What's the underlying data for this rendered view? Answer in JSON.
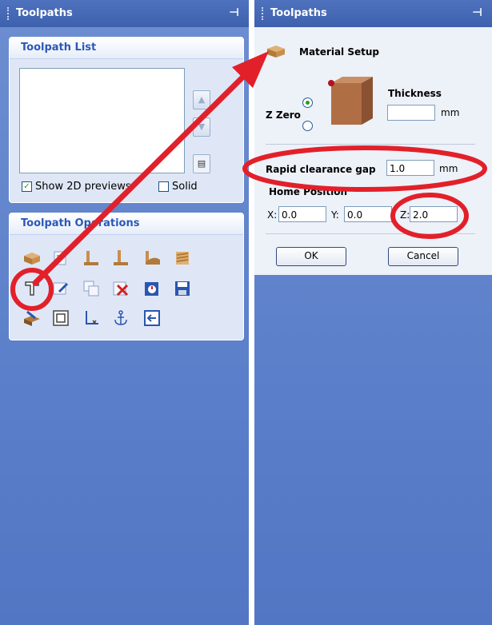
{
  "left_panel": {
    "title": "Toolpaths",
    "pin_glyph": "⊣",
    "toolpath_list": {
      "heading": "Toolpath List",
      "show_2d_previews": {
        "label": "Show 2D previews",
        "checked": true
      },
      "solid": {
        "label": "Solid",
        "checked": false
      }
    },
    "toolpath_operations": {
      "heading": "Toolpath Operations",
      "icons": [
        "material-setup-icon",
        "profile-toolpath-icon",
        "pocket-toolpath-icon",
        "drill-toolpath-icon",
        "v-carve-icon",
        "texture-toolpath-icon",
        "text-tool-icon",
        "edit-toolpath-icon",
        "merge-toolpaths-icon",
        "delete-toolpath-icon",
        "calculate-toolpath-icon",
        "save-toolpath-icon",
        "preview-toolpath-icon",
        "fluting-icon",
        "z-zero-icon",
        "anchor-icon",
        "import-toolpath-icon"
      ]
    }
  },
  "right_panel": {
    "title": "Toolpaths",
    "pin_glyph": "⊣",
    "heading": "Material Setup",
    "z_zero_label": "Z Zero",
    "thickness_label": "Thickness",
    "thickness_value": "",
    "thickness_unit": "mm",
    "rapid_clearance_label": "Rapid clearance gap",
    "rapid_clearance_value": "1.0",
    "rapid_clearance_unit": "mm",
    "home_position_label": "Home Position",
    "x_label": "X:",
    "x_value": "0.0",
    "y_label": "Y:",
    "y_value": "0.0",
    "z_label": "Z:",
    "z_value": "2.0",
    "ok_label": "OK",
    "cancel_label": "Cancel"
  },
  "colors": {
    "panel_blue": "#5b7fca",
    "title_blue": "#3e61ad",
    "highlight_red": "#e2202a"
  }
}
